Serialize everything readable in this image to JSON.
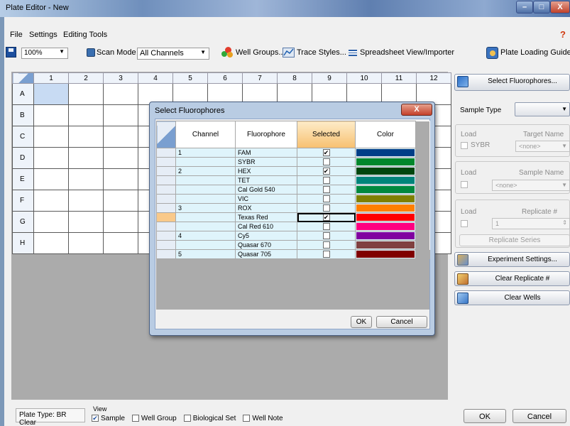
{
  "window": {
    "title": "Plate Editor - New",
    "min": "–",
    "max": "□",
    "close": "X"
  },
  "menu": {
    "file": "File",
    "settings": "Settings",
    "editing_tools": "Editing Tools",
    "help": "?"
  },
  "toolbar": {
    "zoom": "100%",
    "scan_mode_label": "Scan Mode",
    "scan_mode_value": "All Channels",
    "well_groups": "Well Groups...",
    "trace_styles": "Trace Styles...",
    "spreadsheet": "Spreadsheet View/Importer",
    "plate_loading_guide": "Plate Loading Guide"
  },
  "plate": {
    "columns": [
      "1",
      "2",
      "3",
      "4",
      "5",
      "6",
      "7",
      "8",
      "9",
      "10",
      "11",
      "12"
    ],
    "rows": [
      "A",
      "B",
      "C",
      "D",
      "E",
      "F",
      "G",
      "H"
    ]
  },
  "dialog": {
    "title": "Select Fluorophores",
    "close": "X",
    "headers": {
      "channel": "Channel",
      "fluorophore": "Fluorophore",
      "selected": "Selected",
      "color": "Color"
    },
    "rows": [
      {
        "channel": "1",
        "fluorophore": "FAM",
        "selected": true,
        "color": "#003f87"
      },
      {
        "channel": "",
        "fluorophore": "SYBR",
        "selected": false,
        "color": "#00872c"
      },
      {
        "channel": "2",
        "fluorophore": "HEX",
        "selected": true,
        "color": "#00460e"
      },
      {
        "channel": "",
        "fluorophore": "TET",
        "selected": false,
        "color": "#00847a"
      },
      {
        "channel": "",
        "fluorophore": "Cal Gold 540",
        "selected": false,
        "color": "#00883e"
      },
      {
        "channel": "",
        "fluorophore": "VIC",
        "selected": false,
        "color": "#7f8000"
      },
      {
        "channel": "3",
        "fluorophore": "ROX",
        "selected": false,
        "color": "#ff7f00"
      },
      {
        "channel": "",
        "fluorophore": "Texas Red",
        "selected": true,
        "color": "#ff0000"
      },
      {
        "channel": "",
        "fluorophore": "Cal Red 610",
        "selected": false,
        "color": "#ff0080"
      },
      {
        "channel": "4",
        "fluorophore": "Cy5",
        "selected": false,
        "color": "#8000a0"
      },
      {
        "channel": "",
        "fluorophore": "Quasar 670",
        "selected": false,
        "color": "#804040"
      },
      {
        "channel": "5",
        "fluorophore": "Quasar 705",
        "selected": false,
        "color": "#800000"
      }
    ],
    "ok": "OK",
    "cancel": "Cancel"
  },
  "right_panel": {
    "select_fluorophores": "Select Fluorophores...",
    "sample_type_label": "Sample Type",
    "load": "Load",
    "target_name": "Target Name",
    "sybr": "SYBR",
    "none": "<none>",
    "sample_name": "Sample Name",
    "replicate": "Replicate #",
    "replicate_value": "1",
    "replicate_series": "Replicate Series",
    "experiment_settings": "Experiment Settings...",
    "clear_replicate": "Clear Replicate #",
    "clear_wells": "Clear Wells"
  },
  "status": {
    "plate_type": "Plate Type: BR Clear",
    "view_label": "View",
    "view_options": [
      {
        "label": "Sample",
        "checked": true
      },
      {
        "label": "Well Group",
        "checked": false
      },
      {
        "label": "Biological Set",
        "checked": false
      },
      {
        "label": "Well Note",
        "checked": false
      }
    ],
    "ok": "OK",
    "cancel": "Cancel"
  }
}
